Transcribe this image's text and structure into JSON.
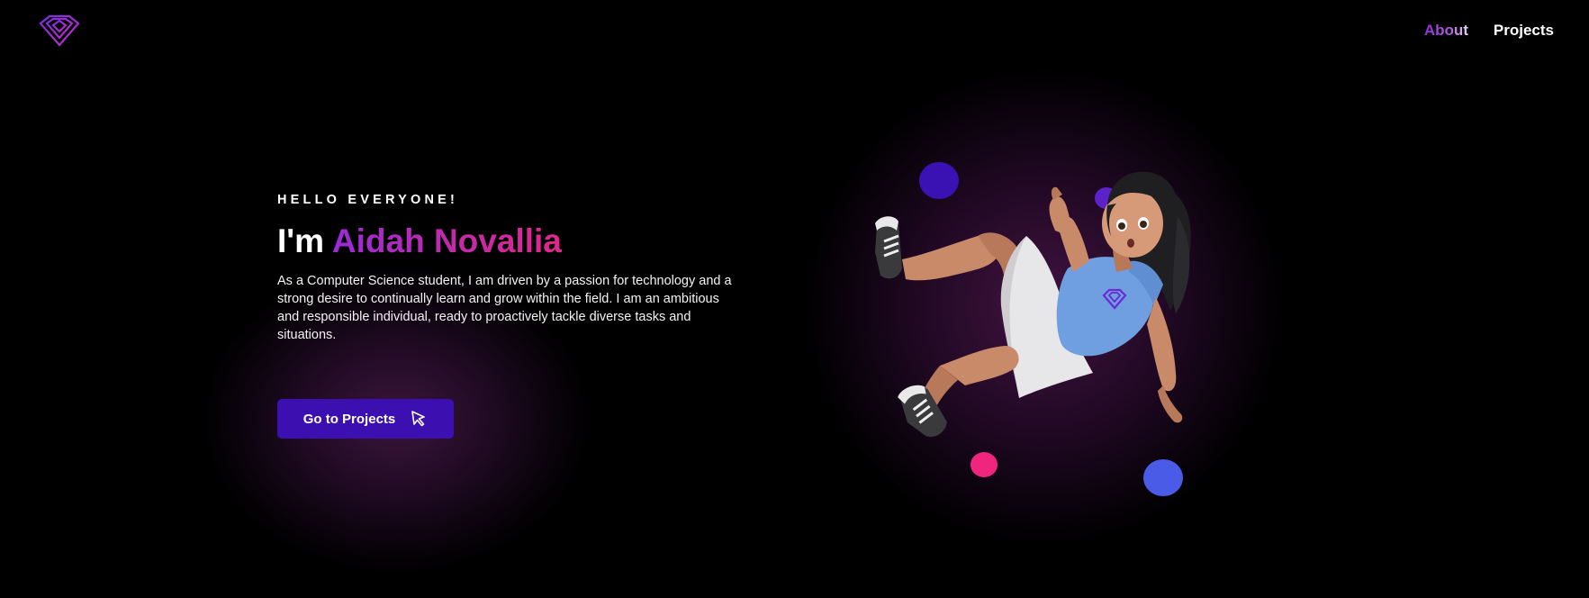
{
  "header": {
    "logo_icon": "diamond-logo-icon",
    "nav": [
      {
        "label": "About",
        "active": true
      },
      {
        "label": "Projects",
        "active": false
      }
    ]
  },
  "hero": {
    "eyebrow": "HELLO EVERYONE!",
    "title_prefix": "I'm",
    "title_name": "Aidah Novallia",
    "description": "As a Computer Science student, I am driven by a passion for technology and a strong desire to continually learn and grow within the field. I am an ambitious and responsible individual, ready to proactively tackle diverse tasks and situations.",
    "cta_label": "Go to Projects",
    "cta_icon": "cursor-arrow-icon"
  },
  "illustration": {
    "subject": "3d-avatar-floating-girl",
    "dot_colors": [
      "#3a12b3",
      "#5a22c8",
      "#f0257e",
      "#4a5be8"
    ]
  },
  "colors": {
    "background": "#000000",
    "accent": "#3c0fb0",
    "name_gradient_start": "#9a2bd9",
    "name_gradient_end": "#e2268c"
  }
}
